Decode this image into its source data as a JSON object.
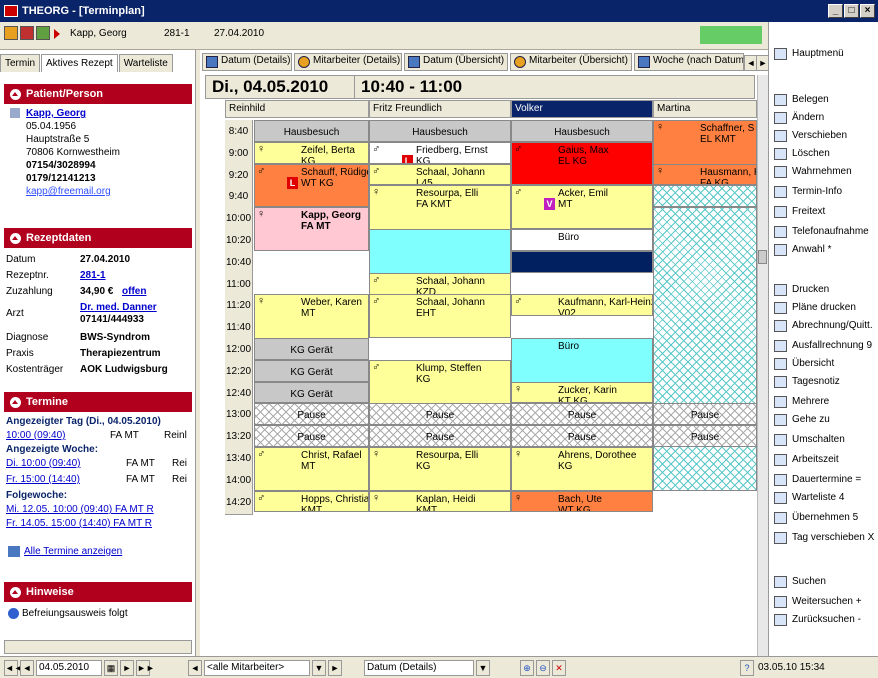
{
  "window": {
    "title": "THEORG - [Terminplan]"
  },
  "toolbar": {
    "patient": "Kapp, Georg",
    "rezept": "281-1",
    "date": "27.04.2010"
  },
  "left": {
    "tabs": [
      "Termin",
      "Aktives Rezept",
      "Warteliste"
    ],
    "patient": {
      "header": "Patient/Person",
      "name": "Kapp, Georg",
      "birth": "05.04.1956",
      "street": "Hauptstraße 5",
      "city": "70806 Kornwestheim",
      "phone": "07154/3028994",
      "mobile": "0179/12141213",
      "email": "kapp@freemail.org"
    },
    "rezept": {
      "header": "Rezeptdaten",
      "rows": [
        {
          "k": "Datum",
          "v": "27.04.2010"
        },
        {
          "k": "Rezeptnr.",
          "v": "281-1"
        },
        {
          "k": "Zuzahlung",
          "v": "34,90 €",
          "v2": "offen"
        },
        {
          "k": "Arzt",
          "v": "Dr. med. Danner",
          "v2": "07141/444933"
        },
        {
          "k": "Diagnose",
          "v": "BWS-Syndrom"
        },
        {
          "k": "Praxis",
          "v": "Therapiezentrum"
        },
        {
          "k": "Kostenträger",
          "v": "AOK Ludwigsburg"
        }
      ]
    },
    "termine": {
      "header": "Termine",
      "day_label": "Angezeigter Tag (Di., 04.05.2010)",
      "day_items": [
        {
          "link": "10:00 (09:40)",
          "txt": "FA MT",
          "who": "Reinl"
        }
      ],
      "week_label": "Angezeigte Woche:",
      "week_items": [
        {
          "link": "Di. 10:00 (09:40)",
          "txt": "FA MT",
          "who": "Rei"
        },
        {
          "link": "Fr. 15:00 (14:40)",
          "txt": "FA MT",
          "who": "Rei"
        }
      ],
      "next_label": "Folgewoche:",
      "next_items": [
        "Mi. 12.05. 10:00 (09:40) FA MT R",
        "Fr. 14.05. 15:00 (14:40) FA MT R"
      ],
      "all_link": "Alle Termine anzeigen"
    },
    "hinweise": {
      "header": "Hinweise",
      "text": "Befreiungsausweis folgt"
    }
  },
  "grid": {
    "tabs": [
      "Datum (Details)",
      "Mitarbeiter (Details)",
      "Datum (Übersicht)",
      "Mitarbeiter (Übersicht)",
      "Woche (nach Datum)"
    ],
    "day": "Di., 04.05.2010",
    "range": "10:40 - 11:00",
    "columns": [
      "Reinhild",
      "Fritz Freundlich",
      "Volker",
      "Martina"
    ],
    "times": [
      "8:40",
      "9:00",
      "9:20",
      "9:40",
      "10:00",
      "10:20",
      "10:40",
      "11:00",
      "11:20",
      "11:40",
      "12:00",
      "12:20",
      "12:40",
      "13:00",
      "13:20",
      "13:40",
      "14:00",
      "14:20"
    ],
    "events": {
      "hb": "Hausbesuch",
      "pause": "Pause",
      "kg": "KG Gerät",
      "buero": "Büro",
      "e1": [
        "Zeifel, Berta",
        "KG"
      ],
      "e2": [
        "Friedberg, Ernst",
        "KG"
      ],
      "e3": [
        "Gaius, Max",
        "EL KG"
      ],
      "e4": [
        "Schaffner, S",
        "EL KMT"
      ],
      "e5": [
        "Schauff, Rüdiger",
        "WT KG"
      ],
      "e6": [
        "Schaal, Johann",
        "L45"
      ],
      "e7": [
        "Hausmann, K",
        "FA KG"
      ],
      "e8": [
        "Resourpa, Elli",
        "FA KMT"
      ],
      "e9": [
        "Acker, Emil",
        "MT"
      ],
      "e10": [
        "Kapp, Georg",
        "FA MT"
      ],
      "e11": [
        "Schaal, Johann",
        "KZD"
      ],
      "e12": [
        "Weber, Karen",
        "MT"
      ],
      "e13": [
        "Schaal, Johann",
        "EHT"
      ],
      "e14": [
        "Kaufmann, Karl-Heinz",
        "V02"
      ],
      "e15": [
        "Klump, Steffen",
        "KG"
      ],
      "e16": [
        "Zucker, Karin",
        "KT KG"
      ],
      "e17": [
        "Christ, Rafael",
        "MT"
      ],
      "e18": [
        "Resourpa, Elli",
        "KG"
      ],
      "e19": [
        "Ahrens, Dorothee",
        "KG"
      ],
      "e20": [
        "Hopps, Christian",
        "KMT"
      ],
      "e21": [
        "Kaplan, Heidi",
        "KMT"
      ],
      "e22": [
        "Bach, Ute",
        "WT KG"
      ]
    }
  },
  "right": {
    "items": [
      "Hauptmenü",
      "Belegen",
      "Ändern",
      "Verschieben",
      "Löschen",
      "Wahrnehmen",
      "Termin-Info",
      "Freitext",
      "Telefonaufnahme",
      "Anwahl *",
      "Drucken",
      "Pläne drucken",
      "Abrechnung/Quitt.",
      "Ausfallrechnung 9",
      "Übersicht",
      "Tagesnotiz",
      "Mehrere",
      "Gehe zu",
      "Umschalten",
      "Arbeitszeit",
      "Dauertermine =",
      "Warteliste 4",
      "Übernehmen 5",
      "Tag verschieben X",
      "Suchen",
      "Weitersuchen +",
      "Zurücksuchen -"
    ]
  },
  "status": {
    "date": "04.05.2010",
    "employee": "<alle Mitarbeiter>",
    "view": "Datum (Details)",
    "clock": "03.05.10  15:34"
  }
}
